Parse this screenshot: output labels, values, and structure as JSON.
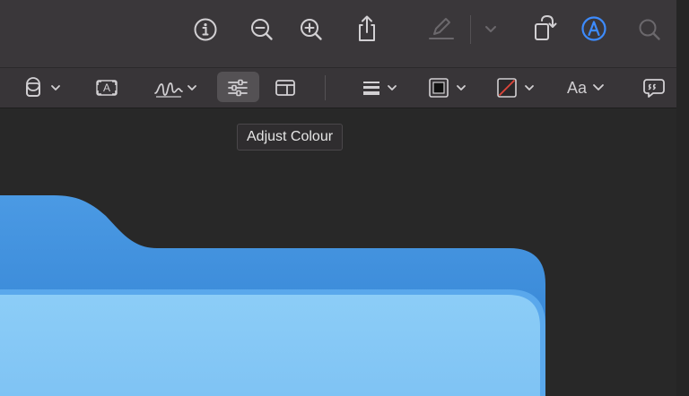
{
  "toolbar": {
    "items": [
      {
        "name": "info-icon"
      },
      {
        "name": "zoom-out-icon"
      },
      {
        "name": "zoom-in-icon"
      },
      {
        "name": "share-icon"
      },
      {
        "name": "highlight-pen-icon",
        "disabled": true
      },
      {
        "name": "chevron-down-icon",
        "disabled": true
      },
      {
        "name": "rotate-icon"
      },
      {
        "name": "markup-icon",
        "active": true
      },
      {
        "name": "search-icon",
        "disabled": true
      }
    ]
  },
  "markup_toolbar": {
    "items": [
      {
        "name": "shapes-icon"
      },
      {
        "name": "text-box-icon",
        "label": "A"
      },
      {
        "name": "signature-icon"
      },
      {
        "name": "adjust-colour-icon",
        "active": true
      },
      {
        "name": "page-layout-icon"
      },
      {
        "name": "line-style-icon"
      },
      {
        "name": "border-colour-icon"
      },
      {
        "name": "fill-colour-icon"
      },
      {
        "name": "text-style-icon",
        "label": "Aa"
      },
      {
        "name": "annotation-icon"
      }
    ]
  },
  "tooltip": {
    "text": "Adjust Colour"
  },
  "colors": {
    "toolbar": "#3a373a",
    "accent": "#3d8bfd",
    "folder_back": "#3f8fdc",
    "folder_front": "#84c7f5",
    "fill_swatch_slash": "#e0463a"
  }
}
